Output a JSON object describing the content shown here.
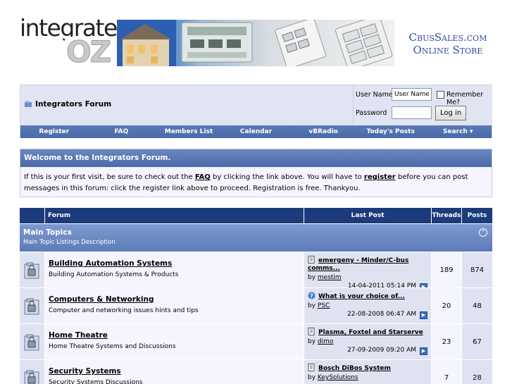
{
  "header": {
    "logo_word": "integrate",
    "logo_oz": "OZ",
    "store_line1": "CbusSales.com",
    "store_line2": "Online Store"
  },
  "navbox": {
    "breadcrumb": "Integrators Forum",
    "login": {
      "username_label": "User Name",
      "username_value": "User Name",
      "remember_label": "Remember Me?",
      "password_label": "Password",
      "password_value": "",
      "login_button": "Log in"
    },
    "nav": [
      "Register",
      "FAQ",
      "Members List",
      "Calendar",
      "vBRadio",
      "Today's Posts",
      "Search ▾"
    ]
  },
  "welcome": {
    "title": "Welcome to the Integrators Forum.",
    "text_1": "If this is your first visit, be sure to check out the ",
    "faq_link": "FAQ",
    "text_2": " by clicking the link above. You will have to ",
    "register_link": "register",
    "text_3": " before you can post messages in this forum: click the register link above to proceed. Registration is free. Thankyou."
  },
  "table": {
    "headers": {
      "forum": "Forum",
      "last_post": "Last Post",
      "threads": "Threads",
      "posts": "Posts"
    },
    "category": {
      "title": "Main Topics",
      "description": "Main Topic Listings Description"
    },
    "rows": [
      {
        "name": "Building Automation Systems",
        "desc": "Building Automation Systems & Products",
        "lp_title": "emergeny - Minder/C-bus comms...",
        "lp_by": "by ",
        "lp_user": "mestim",
        "lp_date": "14-04-2011",
        "lp_time": "05:14 PM",
        "lp_icon": "document-icon",
        "threads": "189",
        "posts": "874"
      },
      {
        "name": "Computers & Networking",
        "desc": "Computer and networking issues hints and tips",
        "lp_title": "What is your choice of...",
        "lp_by": "by ",
        "lp_user": "PSC",
        "lp_date": "22-08-2008",
        "lp_time": "06:47 AM",
        "lp_icon": "question-icon",
        "threads": "20",
        "posts": "48"
      },
      {
        "name": "Home Theatre",
        "desc": "Home Theatre Systems and Discussions",
        "lp_title": "Plasma, Foxtel and Starserve",
        "lp_by": "by ",
        "lp_user": "dimo",
        "lp_date": "27-09-2009",
        "lp_time": "09:20 AM",
        "lp_icon": "document-icon",
        "threads": "23",
        "posts": "67"
      },
      {
        "name": "Security Systems",
        "desc": "Security Systems Discussions",
        "lp_title": "Bosch DiBos System",
        "lp_by": "by ",
        "lp_user": "KeySolutions",
        "lp_date": "",
        "lp_time": "",
        "lp_icon": "document-icon",
        "threads": "7",
        "posts": "28"
      }
    ]
  },
  "colors": {
    "nav_blue": "#486aa8",
    "header_navy": "#1b3b7a",
    "row_light": "#f5f5ff",
    "row_alt": "#dfe3f1",
    "store_text": "#2c4da3"
  }
}
